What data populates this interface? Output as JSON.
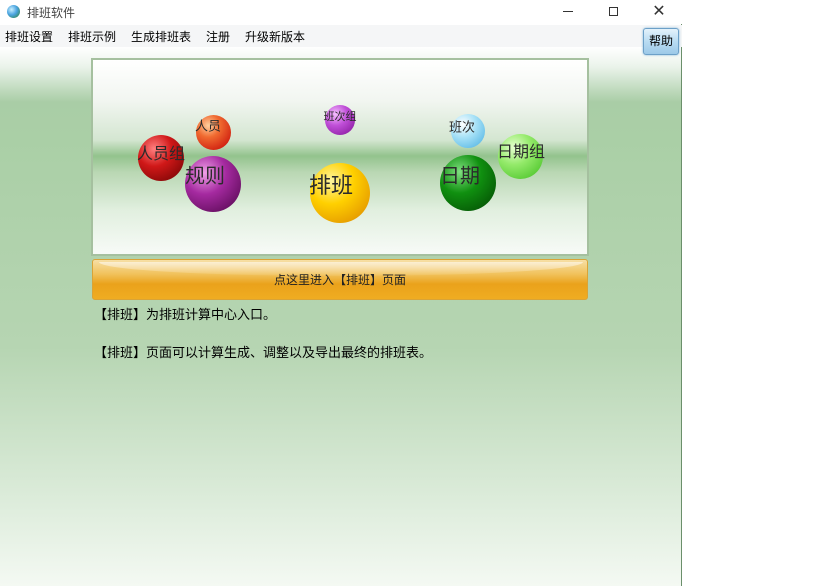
{
  "window": {
    "title": "排班软件",
    "icon": "app-globe-icon"
  },
  "menu": {
    "items": [
      "排班设置",
      "排班示例",
      "生成排班表",
      "注册",
      "升级新版本"
    ]
  },
  "help_label": "帮助",
  "banner": {
    "balls": [
      {
        "label": "人员",
        "color": "#e8402a"
      },
      {
        "label": "人员组",
        "color": "#c01010"
      },
      {
        "label": "规则",
        "color": "#8e1a8a"
      },
      {
        "label": "班次组",
        "color": "#b43cc4"
      },
      {
        "label": "排班",
        "color": "#f2c000"
      },
      {
        "label": "班次",
        "color": "#7fd0f0"
      },
      {
        "label": "日期",
        "color": "#0e8a0e"
      },
      {
        "label": "日期组",
        "color": "#7fe05a"
      }
    ]
  },
  "enter_button_label": "点这里进入【排班】页面",
  "descriptions": [
    "【排班】为排班计算中心入口。",
    "【排班】页面可以计算生成、调整以及导出最终的排班表。"
  ],
  "colors": {
    "accent_orange": "#eea21b",
    "background_green": "#aacfa6",
    "help_blue": "#b9dcf2"
  }
}
